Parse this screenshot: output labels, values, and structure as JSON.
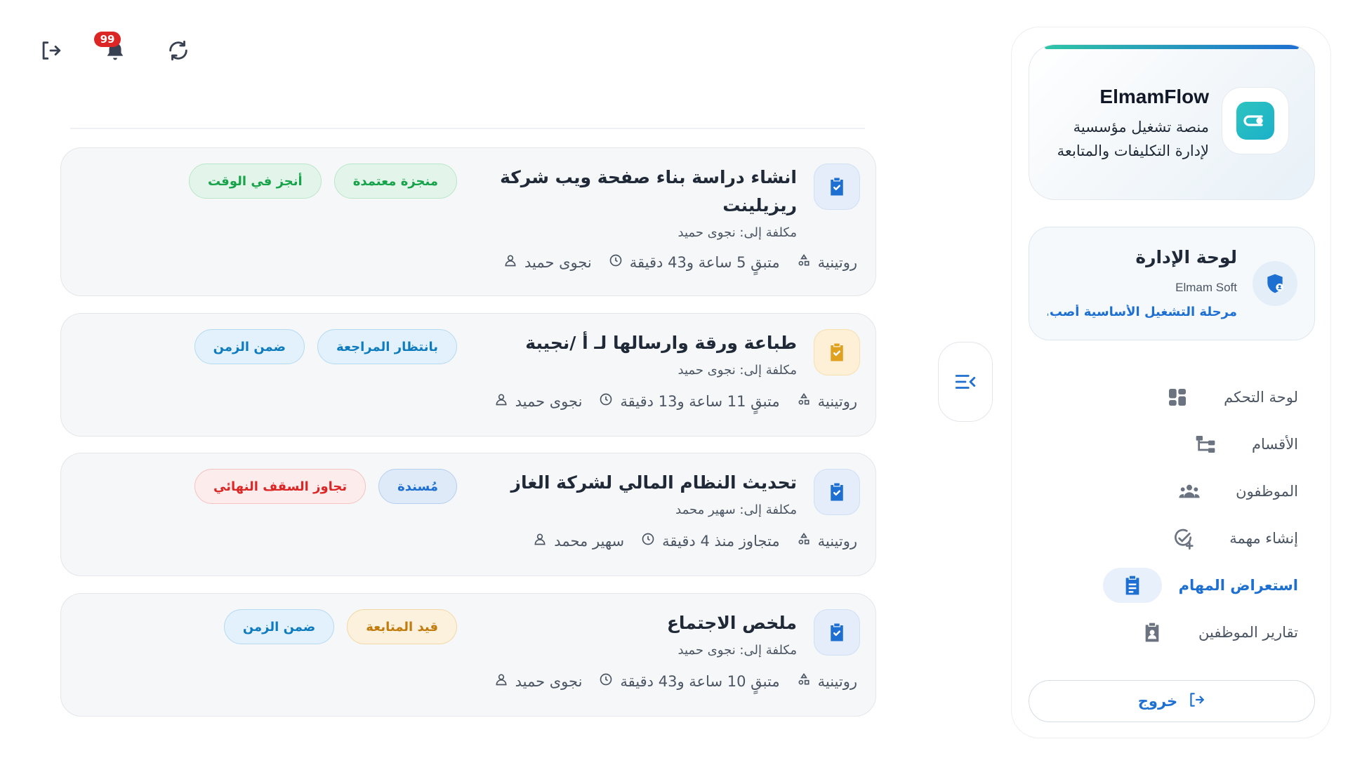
{
  "header": {
    "notification_count": "99"
  },
  "tasks": [
    {
      "title": "انشاء دراسة بناء صفحة ويب شركة ريزيلينت",
      "assigned": "مكلفة إلى: نجوى حميد",
      "person": "نجوى حميد",
      "time": "متبقٍ 5 ساعة و43 دقيقة",
      "type": "روتينية",
      "pills": [
        "منجزة معتمدة",
        "أنجز في الوقت"
      ],
      "icon_color": "#1d6fd1"
    },
    {
      "title": "طباعة ورقة وارسالها لـ أ /نجيبة",
      "assigned": "مكلفة إلى: نجوى حميد",
      "person": "نجوى حميد",
      "time": "متبقٍ 11 ساعة و13 دقيقة",
      "type": "روتينية",
      "pills": [
        "بانتظار المراجعة",
        "ضمن الزمن"
      ],
      "icon_color": "#e0a020"
    },
    {
      "title": "تحديث النظام المالي لشركة الغاز",
      "assigned": "مكلفة إلى: سهير محمد",
      "person": "سهير محمد",
      "time": "متجاوز منذ 4 دقيقة",
      "type": "روتينية",
      "pills": [
        "مُسندة",
        "تجاوز السقف النهائي"
      ],
      "icon_color": "#1d6fd1"
    },
    {
      "title": "ملخص الاجتماع",
      "assigned": "مكلفة إلى: نجوى حميد",
      "person": "نجوى حميد",
      "time": "متبقٍ 10 ساعة و43 دقيقة",
      "type": "روتينية",
      "pills": [
        "قيد المتابعة",
        "ضمن الزمن"
      ],
      "icon_color": "#1d6fd1"
    }
  ],
  "sidebar": {
    "brand_name": "ElmamFlow",
    "brand_desc": "منصة تشغيل مؤسسية لإدارة التكليفات والمتابعة",
    "panel_title": "لوحة الإدارة",
    "panel_company": "Elmam Soft",
    "panel_phase": "مرحلة التشغيل الأساسية أصب...",
    "nav": [
      {
        "label": "لوحة التحكم",
        "icon": "dashboard-icon"
      },
      {
        "label": "الأقسام",
        "icon": "org-tree-icon"
      },
      {
        "label": "الموظفون",
        "icon": "people-icon"
      },
      {
        "label": "إنشاء مهمة",
        "icon": "check-add-icon"
      },
      {
        "label": "استعراض المهام",
        "icon": "clipboard-icon"
      },
      {
        "label": "تقارير الموظفين",
        "icon": "badge-icon"
      }
    ],
    "active_index": 4,
    "logout_label": "خروج"
  },
  "colors": {
    "accent": "#1d6fd1",
    "green": "#16a34a",
    "red": "#dc2626",
    "orange": "#c27c0e"
  }
}
